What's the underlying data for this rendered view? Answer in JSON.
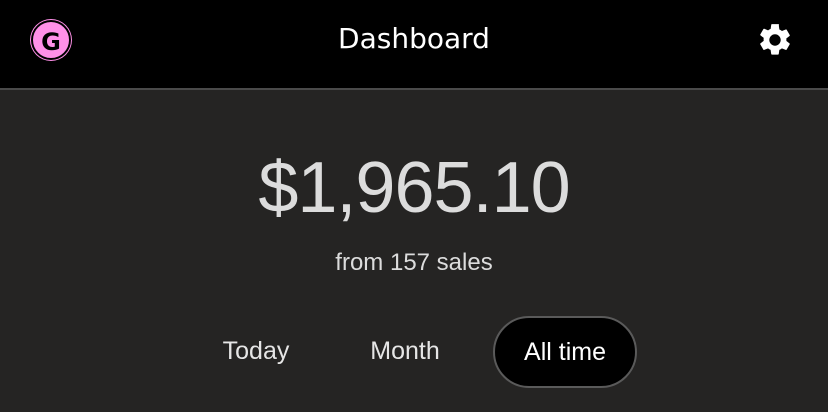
{
  "header": {
    "logo_letter": "G",
    "title": "Dashboard",
    "settings_icon": "gear-icon"
  },
  "summary": {
    "amount": "$1,965.10",
    "subtitle": "from 157 sales"
  },
  "tabs": [
    {
      "label": "Today",
      "selected": false
    },
    {
      "label": "Month",
      "selected": false
    },
    {
      "label": "All time",
      "selected": true
    }
  ],
  "colors": {
    "brand_pink": "#ff90e8",
    "header_bg": "#000000",
    "page_bg": "#252423"
  }
}
